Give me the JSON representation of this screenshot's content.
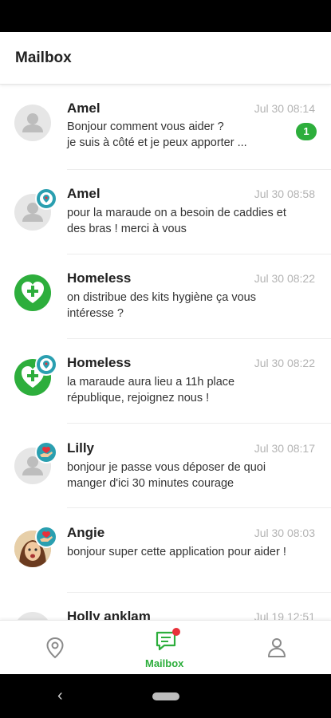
{
  "header": {
    "title": "Mailbox"
  },
  "conversations": [
    {
      "name": "Amel",
      "time": "Jul 30 08:14",
      "message": "Bonjour comment vous aider ?\nje suis à côté et je peux apporter ...",
      "avatar": "person-avatar",
      "badge": null,
      "unread": "1"
    },
    {
      "name": "Amel",
      "time": "Jul 30 08:58",
      "message": "pour la maraude on a besoin de caddies et des bras ! merci à vous",
      "avatar": "person-avatar",
      "badge": "location-pin-icon",
      "unread": null
    },
    {
      "name": "Homeless",
      "time": "Jul 30 08:22",
      "message": "on distribue des kits hygiène ça vous intéresse ?",
      "avatar": "heart-plus-logo",
      "badge": null,
      "unread": null
    },
    {
      "name": "Homeless",
      "time": "Jul 30 08:22",
      "message": "la maraude aura lieu a 11h place république, rejoignez nous !",
      "avatar": "heart-plus-logo",
      "badge": "location-pin-icon",
      "unread": null
    },
    {
      "name": "Lilly",
      "time": "Jul 30 08:17",
      "message": "bonjour je passe vous déposer de quoi manger d'ici 30 minutes   courage",
      "avatar": "person-avatar",
      "badge": "giving-hand-icon",
      "unread": null
    },
    {
      "name": "Angie",
      "time": "Jul 30 08:03",
      "message": "bonjour super cette application pour aider !",
      "avatar": "photo-avatar",
      "badge": "giving-hand-icon",
      "unread": null
    },
    {
      "name": "Holly anklam",
      "time": "Jul 19 12:51",
      "message": "",
      "avatar": "person-avatar",
      "badge": null,
      "unread": null
    }
  ],
  "bottom_nav": {
    "map": {
      "icon": "location-pin-icon"
    },
    "mailbox": {
      "icon": "chat-icon",
      "label": "Mailbox",
      "active": true,
      "has_notification": true
    },
    "profile": {
      "icon": "person-icon"
    }
  },
  "colors": {
    "accent": "#2dae3c",
    "badge": "#2a9fb0",
    "notification": "#e8313a",
    "time": "#b3b3b3"
  }
}
